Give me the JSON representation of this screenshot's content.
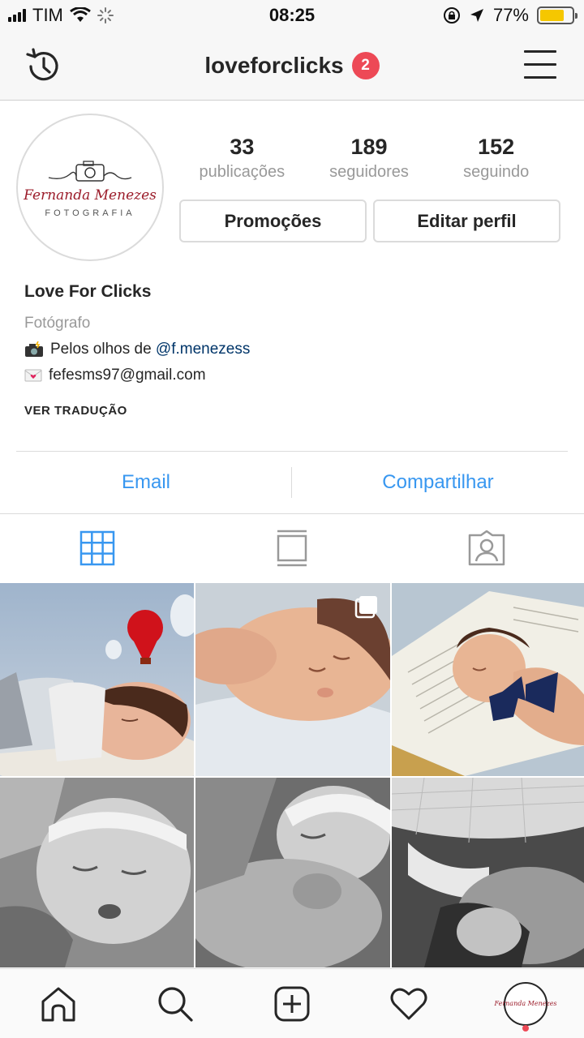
{
  "status_bar": {
    "carrier": "TIM",
    "time": "08:25",
    "battery_percent": "77%",
    "battery_level": 0.77,
    "battery_color": "#f5c700"
  },
  "nav": {
    "username": "loveforclicks",
    "notification_count": "2",
    "icons": [
      "history-icon",
      "menu-icon"
    ]
  },
  "avatar": {
    "script_text": "Fernanda Menezes",
    "sub_text": "FOTOGRAFIA"
  },
  "stats": [
    {
      "value": "33",
      "label": "publicações"
    },
    {
      "value": "189",
      "label": "seguidores"
    },
    {
      "value": "152",
      "label": "seguindo"
    }
  ],
  "buttons": {
    "promo": "Promoções",
    "edit": "Editar perfil"
  },
  "bio": {
    "name": "Love For Clicks",
    "category": "Fotógrafo",
    "line1_text": "Pelos olhos de ",
    "line1_mention": "@f.menezess",
    "line2_text": "fefesms97@gmail.com",
    "translate": "VER TRADUÇÃO"
  },
  "actions": {
    "email": "Email",
    "share": "Compartilhar"
  },
  "tabs": [
    "grid-tab-icon",
    "feed-tab-icon",
    "tagged-tab-icon"
  ],
  "colors": {
    "accent": "#3897f0",
    "badge": "#ed4956",
    "brand_script": "#9b1c2a"
  },
  "bottom_bar": [
    "home-icon",
    "search-icon",
    "new-post-icon",
    "activity-heart-icon",
    "profile-avatar"
  ]
}
